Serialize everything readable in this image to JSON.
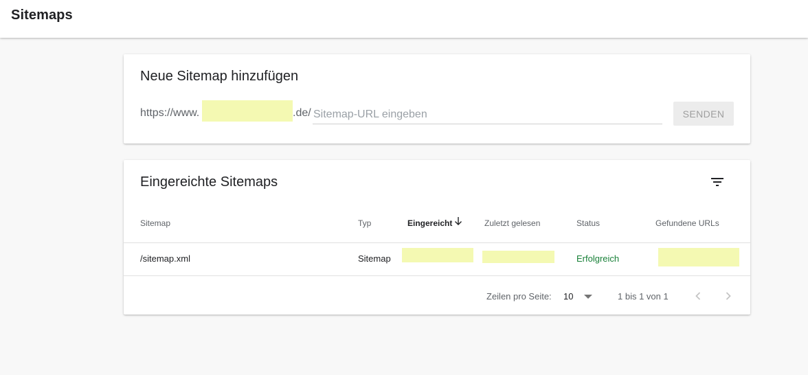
{
  "header": {
    "title": "Sitemaps"
  },
  "add_card": {
    "title": "Neue Sitemap hinzufügen",
    "url_prefix": "https://www.",
    "url_suffix": ".de/",
    "input_placeholder": "Sitemap-URL eingeben",
    "input_value": "",
    "send_label": "SENDEN"
  },
  "list_card": {
    "title": "Eingereichte Sitemaps",
    "columns": [
      "Sitemap",
      "Typ",
      "Eingereicht",
      "Zuletzt gelesen",
      "Status",
      "Gefundene URLs"
    ],
    "sorted_column": "Eingereicht",
    "sort_direction": "descending",
    "rows": [
      {
        "sitemap": "/sitemap.xml",
        "type": "Sitemap",
        "submitted": "",
        "last_read": "",
        "status": "Erfolgreich",
        "found_urls": ""
      }
    ],
    "pagination": {
      "rows_label": "Zeilen pro Seite:",
      "rows_value": "10",
      "range": "1 bis 1 von 1"
    }
  },
  "icons": {
    "filter": "filter-list-icon",
    "sort": "arrow-down-icon",
    "dropdown": "caret-down-icon",
    "prev": "chevron-left-icon",
    "next": "chevron-right-icon"
  },
  "colors": {
    "status_success": "#188038",
    "redaction_highlight": "#f4f9b2",
    "send_button_bg": "#ececec"
  }
}
